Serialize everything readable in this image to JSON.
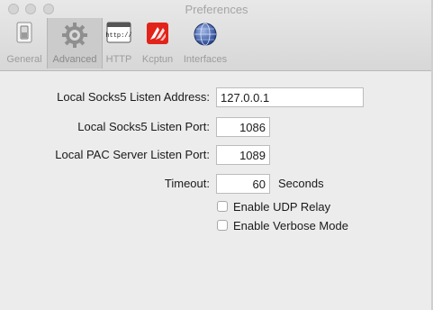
{
  "window": {
    "title": "Preferences"
  },
  "tabs": [
    {
      "label": "General",
      "icon": "switch-icon"
    },
    {
      "label": "Advanced",
      "icon": "gear-icon"
    },
    {
      "label": "HTTP",
      "icon": "http-icon"
    },
    {
      "label": "Kcptun",
      "icon": "kcptun-icon"
    },
    {
      "label": "Interfaces",
      "icon": "network-globe-icon"
    }
  ],
  "active_tab": "Advanced",
  "form": {
    "listen_address_label": "Local Socks5 Listen Address:",
    "listen_address_value": "127.0.0.1",
    "listen_port_label": "Local Socks5 Listen Port:",
    "listen_port_value": "1086",
    "pac_port_label": "Local PAC Server Listen Port:",
    "pac_port_value": "1089",
    "timeout_label": "Timeout:",
    "timeout_value": "60",
    "timeout_unit": "Seconds",
    "udp_relay_label": "Enable UDP Relay",
    "udp_relay_checked": false,
    "verbose_label": "Enable Verbose Mode",
    "verbose_checked": false
  },
  "colors": {
    "kcptun_red": "#e2231a",
    "window_bg": "#ececec"
  }
}
